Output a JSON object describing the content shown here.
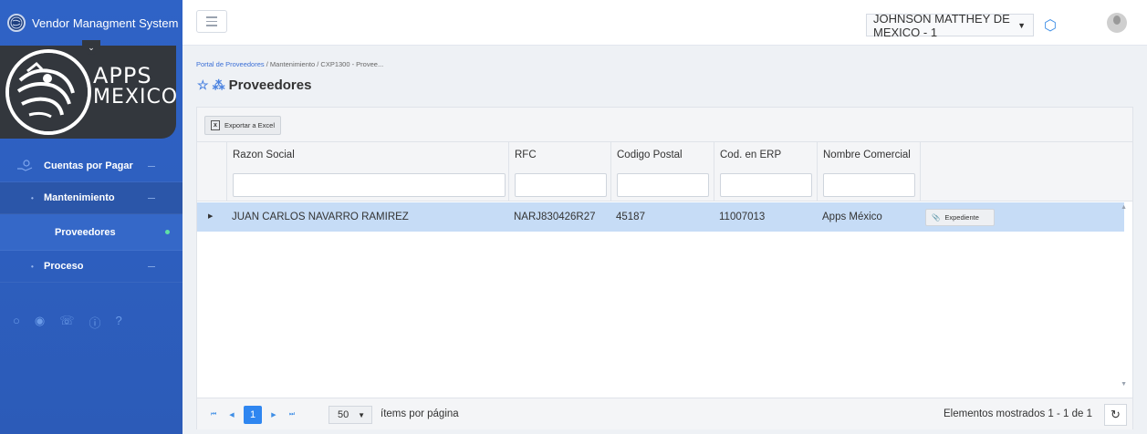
{
  "sidebar": {
    "title": "Vendor Managment System",
    "logo_text_line1": "APPS",
    "logo_text_line2": "MEXICO",
    "menu": {
      "cuentas": "Cuentas por Pagar",
      "mantenimiento": "Mantenimiento",
      "proveedores": "Proveedores",
      "proceso": "Proceso"
    },
    "footer_icons": [
      "chat-icon",
      "globe-icon",
      "phone-icon",
      "info-icon",
      "help-icon"
    ]
  },
  "topbar": {
    "company": "JOHNSON MATTHEY DE MEXICO - 1"
  },
  "breadcrumb": {
    "root": "Portal de Proveedores",
    "sep": "/",
    "level1": "Mantenimiento",
    "level2": "CXP1300 - Provee..."
  },
  "page": {
    "title": "Proveedores"
  },
  "toolbar": {
    "export": "Exportar a Excel"
  },
  "grid": {
    "columns": [
      "Razon Social",
      "RFC",
      "Codigo Postal",
      "Cod. en ERP",
      "Nombre Comercial"
    ],
    "rows": [
      {
        "razon_social": "JUAN CARLOS NAVARRO RAMIREZ",
        "rfc": "NARJ830426R27",
        "codigo_postal": "45187",
        "cod_erp": "11007013",
        "nombre_comercial": "Apps México",
        "action": "Expediente"
      }
    ]
  },
  "pager": {
    "current_page": "1",
    "page_size": "50",
    "per_page_label": "ítems por página",
    "shown": "Elementos mostrados 1 - 1 de 1"
  },
  "colors": {
    "sidebar": "#2f63c6",
    "accent": "#2f86f0",
    "selected_row": "#c6dcf6"
  }
}
